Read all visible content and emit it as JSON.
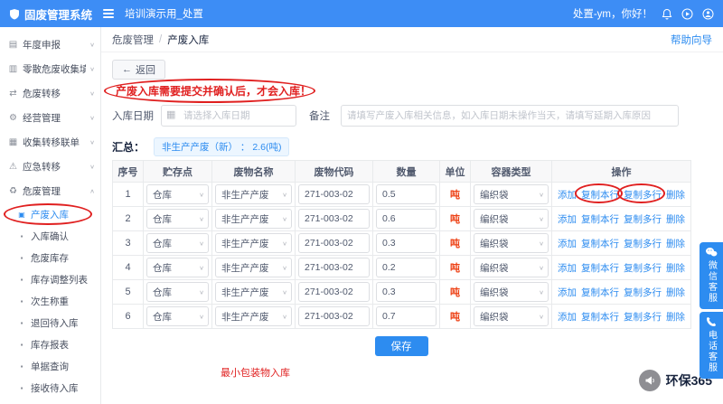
{
  "topbar": {
    "brand": "固废管理系统",
    "page_title": "培训演示用_处置",
    "greeting": "处置-ym，你好！"
  },
  "icons": {
    "caret_down": "∨",
    "chevron_up": "∧",
    "back_arrow": "←",
    "calendar": "▦"
  },
  "sidebar": {
    "items": [
      {
        "label": "年度申报",
        "icon": "▤"
      },
      {
        "label": "零散危废收集填报",
        "icon": "▥"
      },
      {
        "label": "危废转移",
        "icon": "⇄"
      },
      {
        "label": "经营管理",
        "icon": "⚙"
      },
      {
        "label": "收集转移联单",
        "icon": "▦"
      },
      {
        "label": "应急转移",
        "icon": "⚠"
      },
      {
        "label": "危废管理",
        "icon": "♻"
      }
    ],
    "subitems": [
      {
        "label": "产废入库",
        "icon": "▣"
      },
      {
        "label": "入库确认",
        "icon": "▪"
      },
      {
        "label": "危废库存",
        "icon": "▪"
      },
      {
        "label": "库存调整列表",
        "icon": "▪"
      },
      {
        "label": "次生称重",
        "icon": "▪"
      },
      {
        "label": "退回待入库",
        "icon": "▪"
      },
      {
        "label": "库存报表",
        "icon": "▪"
      },
      {
        "label": "单据查询",
        "icon": "▪"
      },
      {
        "label": "接收待入库",
        "icon": "▪"
      }
    ]
  },
  "breadcrumb": {
    "root": "危废管理",
    "separator": "/",
    "current": "产废入库",
    "help": "帮助向导"
  },
  "toolbar": {
    "back": "返回"
  },
  "notice": "产废入库需要提交并确认后，才会入库！",
  "form": {
    "date_label": "入库日期",
    "date_placeholder": "请选择入库日期",
    "remark_label": "备注",
    "remark_placeholder": "请填写产废入库相关信息，如入库日期未操作当天，请填写延期入库原因"
  },
  "summary": {
    "label": "汇总：",
    "tag": "非生产产废（新） ： 2.6(吨)"
  },
  "table": {
    "headers": [
      "序号",
      "贮存点",
      "废物名称",
      "废物代码",
      "数量",
      "单位",
      "容器类型",
      "操作"
    ],
    "ops": {
      "add": "添加",
      "copy_row": "复制本行",
      "copy_multi": "复制多行",
      "delete": "删除"
    },
    "rows": [
      {
        "no": "1",
        "store": "仓库",
        "name": "非生产产废",
        "code": "271-003-02",
        "qty": "0.5",
        "unit": "吨",
        "container": "编织袋"
      },
      {
        "no": "2",
        "store": "仓库",
        "name": "非生产产废",
        "code": "271-003-02",
        "qty": "0.6",
        "unit": "吨",
        "container": "编织袋"
      },
      {
        "no": "3",
        "store": "仓库",
        "name": "非生产产废",
        "code": "271-003-02",
        "qty": "0.3",
        "unit": "吨",
        "container": "编织袋"
      },
      {
        "no": "4",
        "store": "仓库",
        "name": "非生产产废",
        "code": "271-003-02",
        "qty": "0.2",
        "unit": "吨",
        "container": "编织袋"
      },
      {
        "no": "5",
        "store": "仓库",
        "name": "非生产产废",
        "code": "271-003-02",
        "qty": "0.3",
        "unit": "吨",
        "container": "编织袋"
      },
      {
        "no": "6",
        "store": "仓库",
        "name": "非生产产废",
        "code": "271-003-02",
        "qty": "0.7",
        "unit": "吨",
        "container": "编织袋"
      }
    ]
  },
  "save_button": "保存",
  "footnote": "最小包装物入库",
  "float_buttons": [
    {
      "label": "微信客服"
    },
    {
      "label": "电话客服"
    }
  ],
  "watermark": "环保365",
  "colors": {
    "primary": "#2d8cf0",
    "topbar": "#3d8df5",
    "danger": "#ed4014",
    "annotation": "#e02020"
  }
}
